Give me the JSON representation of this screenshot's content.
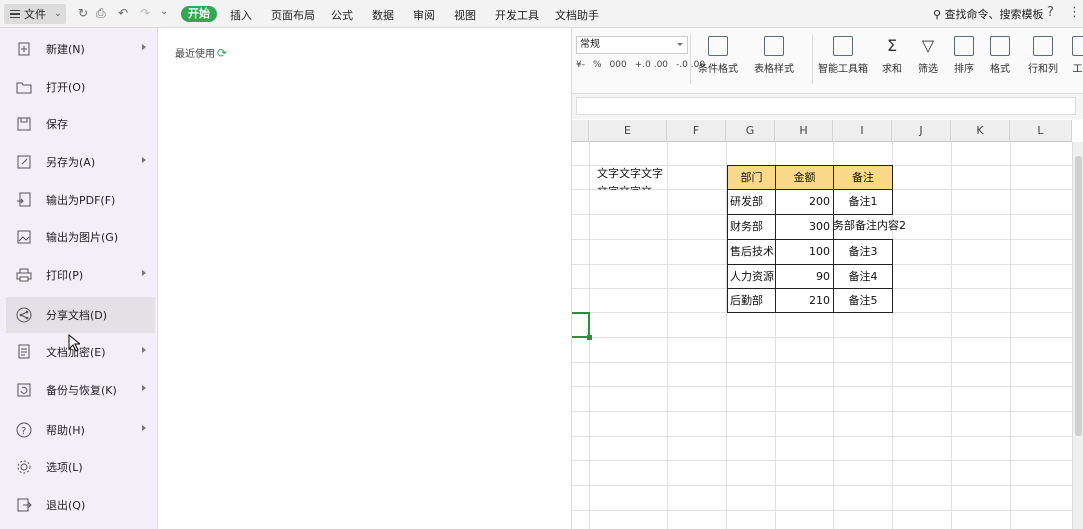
{
  "menubar": {
    "file_label": "文件",
    "tabs": [
      "开始",
      "插入",
      "页面布局",
      "公式",
      "数据",
      "审阅",
      "视图",
      "开发工具",
      "文档助手"
    ],
    "active_tab": "开始",
    "search_label": "查找命令、搜索模板",
    "help_label": "?"
  },
  "ribbon": {
    "number_format": "常规",
    "number_buttons": [
      "¥-",
      "%",
      "000",
      "+.0 .00",
      "-.0 .00"
    ],
    "buttons": [
      "条件格式",
      "表格样式",
      "智能工具箱",
      "求和",
      "筛选",
      "排序",
      "格式",
      "行和列",
      "工"
    ]
  },
  "file_menu": {
    "items": [
      {
        "label": "新建(N)",
        "icon": "new-file-icon",
        "submenu": true
      },
      {
        "label": "打开(O)",
        "icon": "folder-open-icon",
        "submenu": false
      },
      {
        "label": "保存",
        "icon": "save-icon",
        "submenu": false
      },
      {
        "label": "另存为(A)",
        "icon": "save-as-icon",
        "submenu": true
      },
      {
        "label": "输出为PDF(F)",
        "icon": "export-pdf-icon",
        "submenu": false
      },
      {
        "label": "输出为图片(G)",
        "icon": "export-image-icon",
        "submenu": false
      },
      {
        "label": "打印(P)",
        "icon": "printer-icon",
        "submenu": true
      },
      {
        "label": "分享文档(D)",
        "icon": "share-icon",
        "submenu": false
      },
      {
        "label": "文档加密(E)",
        "icon": "encrypt-icon",
        "submenu": true
      },
      {
        "label": "备份与恢复(K)",
        "icon": "backup-icon",
        "submenu": true
      },
      {
        "label": "帮助(H)",
        "icon": "help-icon",
        "submenu": true
      },
      {
        "label": "选项(L)",
        "icon": "gear-icon",
        "submenu": false
      },
      {
        "label": "退出(Q)",
        "icon": "exit-icon",
        "submenu": false
      }
    ],
    "recent_label": "最近使用"
  },
  "sheet": {
    "columns": [
      "E",
      "F",
      "G",
      "H",
      "I",
      "J",
      "K",
      "L"
    ],
    "text_cell": "文字文字文字",
    "table_header": [
      "部门",
      "金额",
      "备注"
    ],
    "table_rows": [
      [
        "研发部",
        "200",
        "备注1"
      ],
      [
        "财务部",
        "300",
        "务部备注内容2"
      ],
      [
        "售后技术",
        "100",
        "备注3"
      ],
      [
        "人力资源",
        "90",
        "备注4"
      ],
      [
        "后勤部",
        "210",
        "备注5"
      ]
    ]
  },
  "colors": {
    "accent": "#31a854",
    "header_fill": "#fbd98a",
    "menu_bg": "#f3eef8"
  }
}
